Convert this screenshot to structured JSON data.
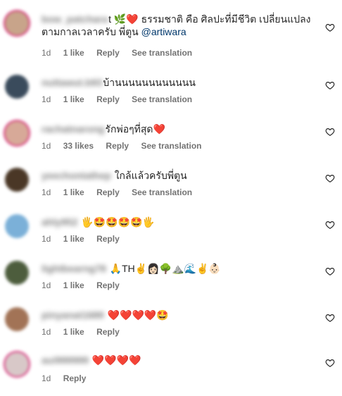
{
  "comments": [
    {
      "username": "bow_patchara",
      "text": "t 🌿❤️ ธรรมชาติ คือ ศิลปะที่มีชีวิต เปลี่ยนแปลงตามกาลเวลาครับ พี่ตูน",
      "mention": "@artiwara",
      "time": "1d",
      "likes": "1 like",
      "reply": "Reply",
      "see": "See translation"
    },
    {
      "username": "nuttawut.b93",
      "text": "บ้านนนนนนนนนนนน",
      "mention": "",
      "time": "1d",
      "likes": "1 like",
      "reply": "Reply",
      "see": "See translation"
    },
    {
      "username": "rachatnarong",
      "text": "รักพ่อๆที่สุด❤️",
      "mention": "",
      "time": "1d",
      "likes": "33 likes",
      "reply": "Reply",
      "see": "See translation"
    },
    {
      "username": "yeechontathep",
      "text": "ใกล้แล้วครับพี่ตูน",
      "mention": "",
      "time": "1d",
      "likes": "1 like",
      "reply": "Reply",
      "see": "See translation"
    },
    {
      "username": "ahly952",
      "text": "🖐🤩🤩🤩🤩🖐",
      "mention": "",
      "time": "1d",
      "likes": "1 like",
      "reply": "Reply",
      "see": ""
    },
    {
      "username": "lightbearng78",
      "text": "🙏TH✌️👩🏻🌳⛰️🌊✌️👶🏻",
      "mention": "",
      "time": "1d",
      "likes": "1 like",
      "reply": "Reply",
      "see": ""
    },
    {
      "username": "pinyanat1689",
      "text": "❤️❤️❤️❤️🤩",
      "mention": "",
      "time": "1d",
      "likes": "1 like",
      "reply": "Reply",
      "see": ""
    },
    {
      "username": "aui999999",
      "text": "❤️❤️❤️❤️",
      "mention": "",
      "time": "1d",
      "likes": "",
      "reply": "Reply",
      "see": ""
    }
  ],
  "colors": {
    "avatars": [
      "#c8a48a",
      "#3a4b5c",
      "#d7a998",
      "#4a3726",
      "#7bb0d8",
      "#4d5d3d",
      "#a27356",
      "#d8c8c8"
    ],
    "mention": "#00376b",
    "meta": "#737373",
    "ring": "#d62976"
  },
  "icons": {
    "like": "heart-outline-icon"
  }
}
